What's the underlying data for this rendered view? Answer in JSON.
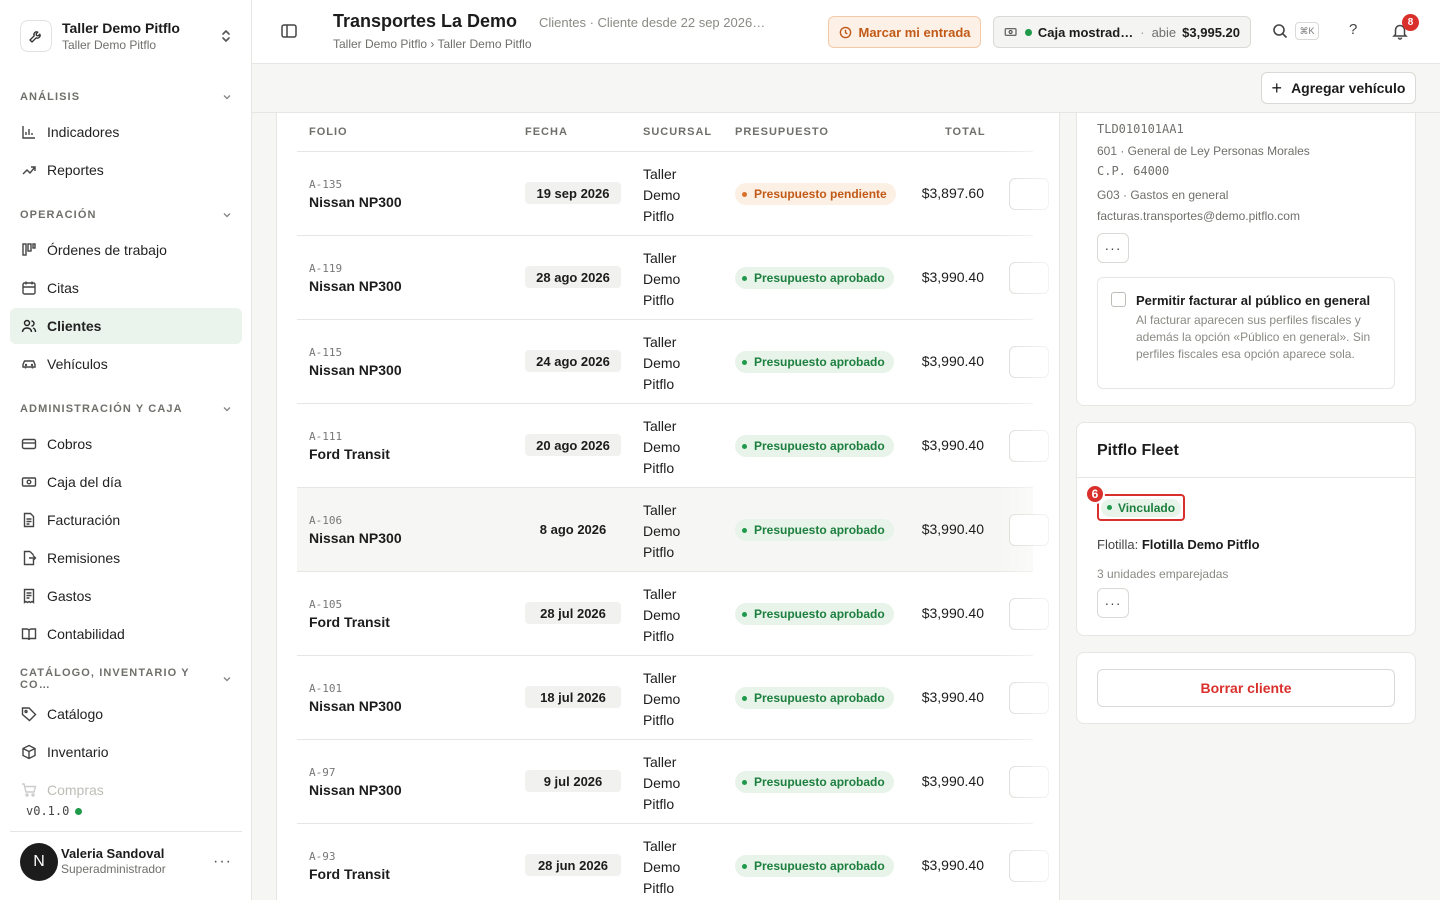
{
  "org": {
    "name": "Taller Demo Pitflo",
    "sub": "Taller Demo Pitflo"
  },
  "nav": {
    "analisis": {
      "label": "Análisis",
      "items": [
        "Indicadores",
        "Reportes"
      ]
    },
    "operacion": {
      "label": "Operación",
      "items": [
        "Órdenes de trabajo",
        "Citas",
        "Clientes",
        "Vehículos"
      ]
    },
    "admin": {
      "label": "Administración y caja",
      "items": [
        "Cobros",
        "Caja del día",
        "Facturación",
        "Remisiones",
        "Gastos",
        "Contabilidad"
      ]
    },
    "catalogo": {
      "label": "Catálogo, inventario y co…",
      "items": [
        "Catálogo",
        "Inventario",
        "Compras"
      ]
    },
    "active": "Clientes"
  },
  "version": "v0.1.0",
  "user": {
    "initial": "N",
    "name": "Valeria Sandoval",
    "role": "Superadministrador",
    "more": "···"
  },
  "header": {
    "title": "Transportes La Demo",
    "subtitle": "Clientes · Cliente desde 22 sep 2026…",
    "breadcrumb": "Taller Demo Pitflo › Taller Demo Pitflo",
    "clock_in": "Marcar mi entrada",
    "caja": {
      "name": "Caja mostrad…",
      "sep": "·",
      "status": "abie",
      "amount": "$3,995.20"
    },
    "kbd": "⌘K",
    "help": "?",
    "notifications": "8"
  },
  "toolbar": {
    "add_vehicle": "Agregar vehículo",
    "add_symbol": "+"
  },
  "table": {
    "columns": {
      "folio": "FOLIO",
      "fecha": "FECHA",
      "sucursal": "SUCURSAL",
      "presupuesto": "PRESUPUESTO",
      "total": "TOTAL"
    },
    "rows": [
      {
        "folio": "A-135",
        "vehicle": "Nissan NP300",
        "date": "19 sep 2026",
        "branch": "Taller Demo Pitflo",
        "status": "Presupuesto pendiente",
        "status_kind": "pend",
        "total": "$3,897.60"
      },
      {
        "folio": "A-119",
        "vehicle": "Nissan NP300",
        "date": "28 ago 2026",
        "branch": "Taller Demo Pitflo",
        "status": "Presupuesto aprobado",
        "status_kind": "ok",
        "total": "$3,990.40"
      },
      {
        "folio": "A-115",
        "vehicle": "Nissan NP300",
        "date": "24 ago 2026",
        "branch": "Taller Demo Pitflo",
        "status": "Presupuesto aprobado",
        "status_kind": "ok",
        "total": "$3,990.40"
      },
      {
        "folio": "A-111",
        "vehicle": "Ford Transit",
        "date": "20 ago 2026",
        "branch": "Taller Demo Pitflo",
        "status": "Presupuesto aprobado",
        "status_kind": "ok",
        "total": "$3,990.40"
      },
      {
        "folio": "A-106",
        "vehicle": "Nissan NP300",
        "date": "8 ago 2026",
        "branch": "Taller Demo Pitflo",
        "status": "Presupuesto aprobado",
        "status_kind": "ok",
        "total": "$3,990.40"
      },
      {
        "folio": "A-105",
        "vehicle": "Ford Transit",
        "date": "28 jul 2026",
        "branch": "Taller Demo Pitflo",
        "status": "Presupuesto aprobado",
        "status_kind": "ok",
        "total": "$3,990.40"
      },
      {
        "folio": "A-101",
        "vehicle": "Nissan NP300",
        "date": "18 jul 2026",
        "branch": "Taller Demo Pitflo",
        "status": "Presupuesto aprobado",
        "status_kind": "ok",
        "total": "$3,990.40"
      },
      {
        "folio": "A-97",
        "vehicle": "Nissan NP300",
        "date": "9 jul 2026",
        "branch": "Taller Demo Pitflo",
        "status": "Presupuesto aprobado",
        "status_kind": "ok",
        "total": "$3,990.40"
      },
      {
        "folio": "A-93",
        "vehicle": "Ford Transit",
        "date": "28 jun 2026",
        "branch": "Taller Demo Pitflo",
        "status": "Presupuesto aprobado",
        "status_kind": "ok",
        "total": "$3,990.40"
      }
    ]
  },
  "fiscal": {
    "rfc": "TLD010101AA1",
    "regimen": "601 · General de Ley Personas Morales",
    "cp": "C.P. 64000",
    "uso": "G03 · Gastos en general",
    "email": "facturas.transportes@demo.pitflo.com",
    "more": "···",
    "public_title": "Permitir facturar al público en general",
    "public_desc": "Al facturar aparecen sus perfiles fiscales y además la opción «Público en general». Sin perfiles fiscales esa opción aparece sola."
  },
  "fleet": {
    "title": "Pitflo Fleet",
    "status": "Vinculado",
    "marker": "6",
    "fleet_label": "Flotilla:",
    "fleet_name": "Flotilla Demo Pitflo",
    "units": "3 unidades emparejadas",
    "more": "···"
  },
  "delete_label": "Borrar cliente",
  "colors": {
    "accent_green": "#1f9a4a",
    "danger": "#d9302c",
    "warning": "#c25a17"
  }
}
